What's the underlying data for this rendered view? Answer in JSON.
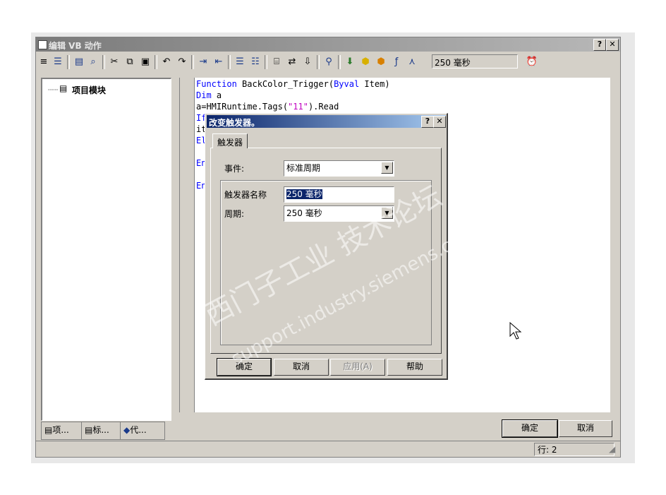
{
  "window": {
    "title": "编辑 VB 动作",
    "help_label": "?",
    "close_label": "✕"
  },
  "toolbar": {
    "trigger_combo": "250 毫秒"
  },
  "tree": {
    "root_label": "项目模块"
  },
  "code_lines": [
    [
      {
        "t": "Function",
        "c": "kw"
      },
      {
        "t": " BackColor_Trigger(",
        "c": ""
      },
      {
        "t": "Byval",
        "c": "kw"
      },
      {
        "t": " Item)",
        "c": ""
      }
    ],
    [
      {
        "t": "Dim",
        "c": "kw"
      },
      {
        "t": " a",
        "c": ""
      }
    ],
    [
      {
        "t": "a=HMIRuntime.Tags(",
        "c": ""
      },
      {
        "t": "\"11\"",
        "c": "str"
      },
      {
        "t": ").Read",
        "c": ""
      }
    ],
    [
      {
        "t": "If",
        "c": "kw"
      }
    ],
    [
      {
        "t": "it",
        "c": ""
      }
    ],
    [
      {
        "t": "El",
        "c": "kw"
      }
    ],
    [
      {
        "t": "",
        "c": ""
      }
    ],
    [
      {
        "t": "En",
        "c": "kw"
      }
    ],
    [
      {
        "t": "",
        "c": ""
      }
    ],
    [
      {
        "t": "En",
        "c": "kw"
      }
    ]
  ],
  "bottom_tabs": [
    "项...",
    "标...",
    "代..."
  ],
  "buttons": {
    "ok": "确定",
    "cancel": "取消"
  },
  "status": {
    "line": "行: 2"
  },
  "dialog": {
    "title": "改变触发器。",
    "help_label": "?",
    "close_label": "✕",
    "tab_label": "触发器",
    "event_label": "事件:",
    "event_value": "标准周期",
    "trigger_name_label": "触发器名称",
    "trigger_name_value": "250 毫秒",
    "period_label": "周期:",
    "period_value": "250 毫秒",
    "ok": "确定",
    "cancel": "取消",
    "apply": "应用(A)",
    "help": "帮助"
  },
  "watermark": {
    "line1": "西门子工业 技术论坛",
    "line2": "support.industry.siemens.com/cs"
  }
}
